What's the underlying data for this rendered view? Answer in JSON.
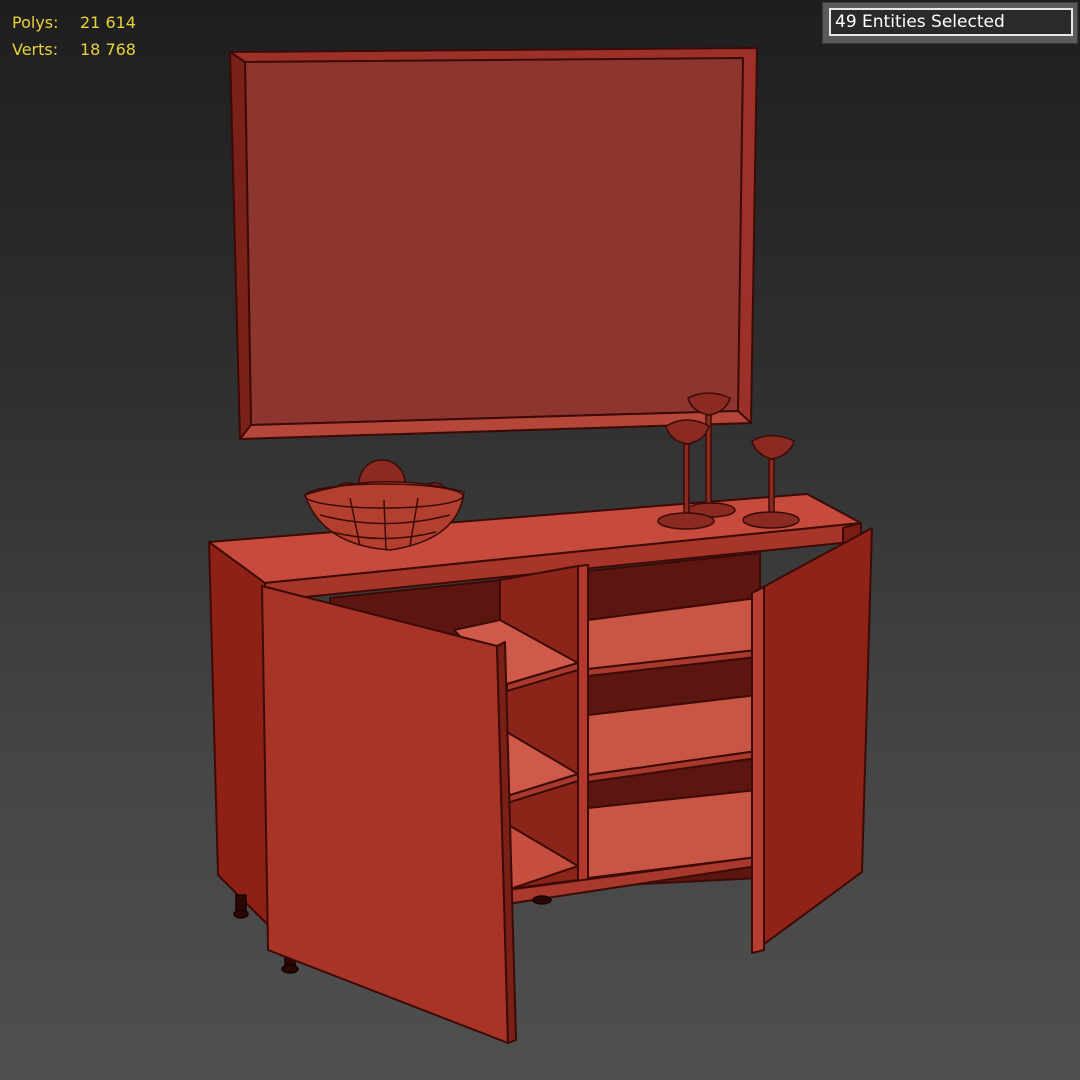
{
  "viewport_stats": {
    "polys_label": "Polys:",
    "polys_value": "21 614",
    "verts_label": "Verts:",
    "verts_value": "18 768"
  },
  "selection": {
    "text": "49 Entities Selected"
  },
  "colors": {
    "stats_text": "#e8d23a",
    "model_red": "#a63428",
    "model_dark": "#6e1a13",
    "wire": "#3c0b07",
    "background_top": "#1e1e1e",
    "background_bottom": "#4f4f4f"
  },
  "scene": {
    "objects": [
      "tv-frame",
      "sideboard-cabinet",
      "left-door",
      "right-door",
      "shelves",
      "fruit-bowl",
      "candle-holders",
      "legs"
    ]
  }
}
